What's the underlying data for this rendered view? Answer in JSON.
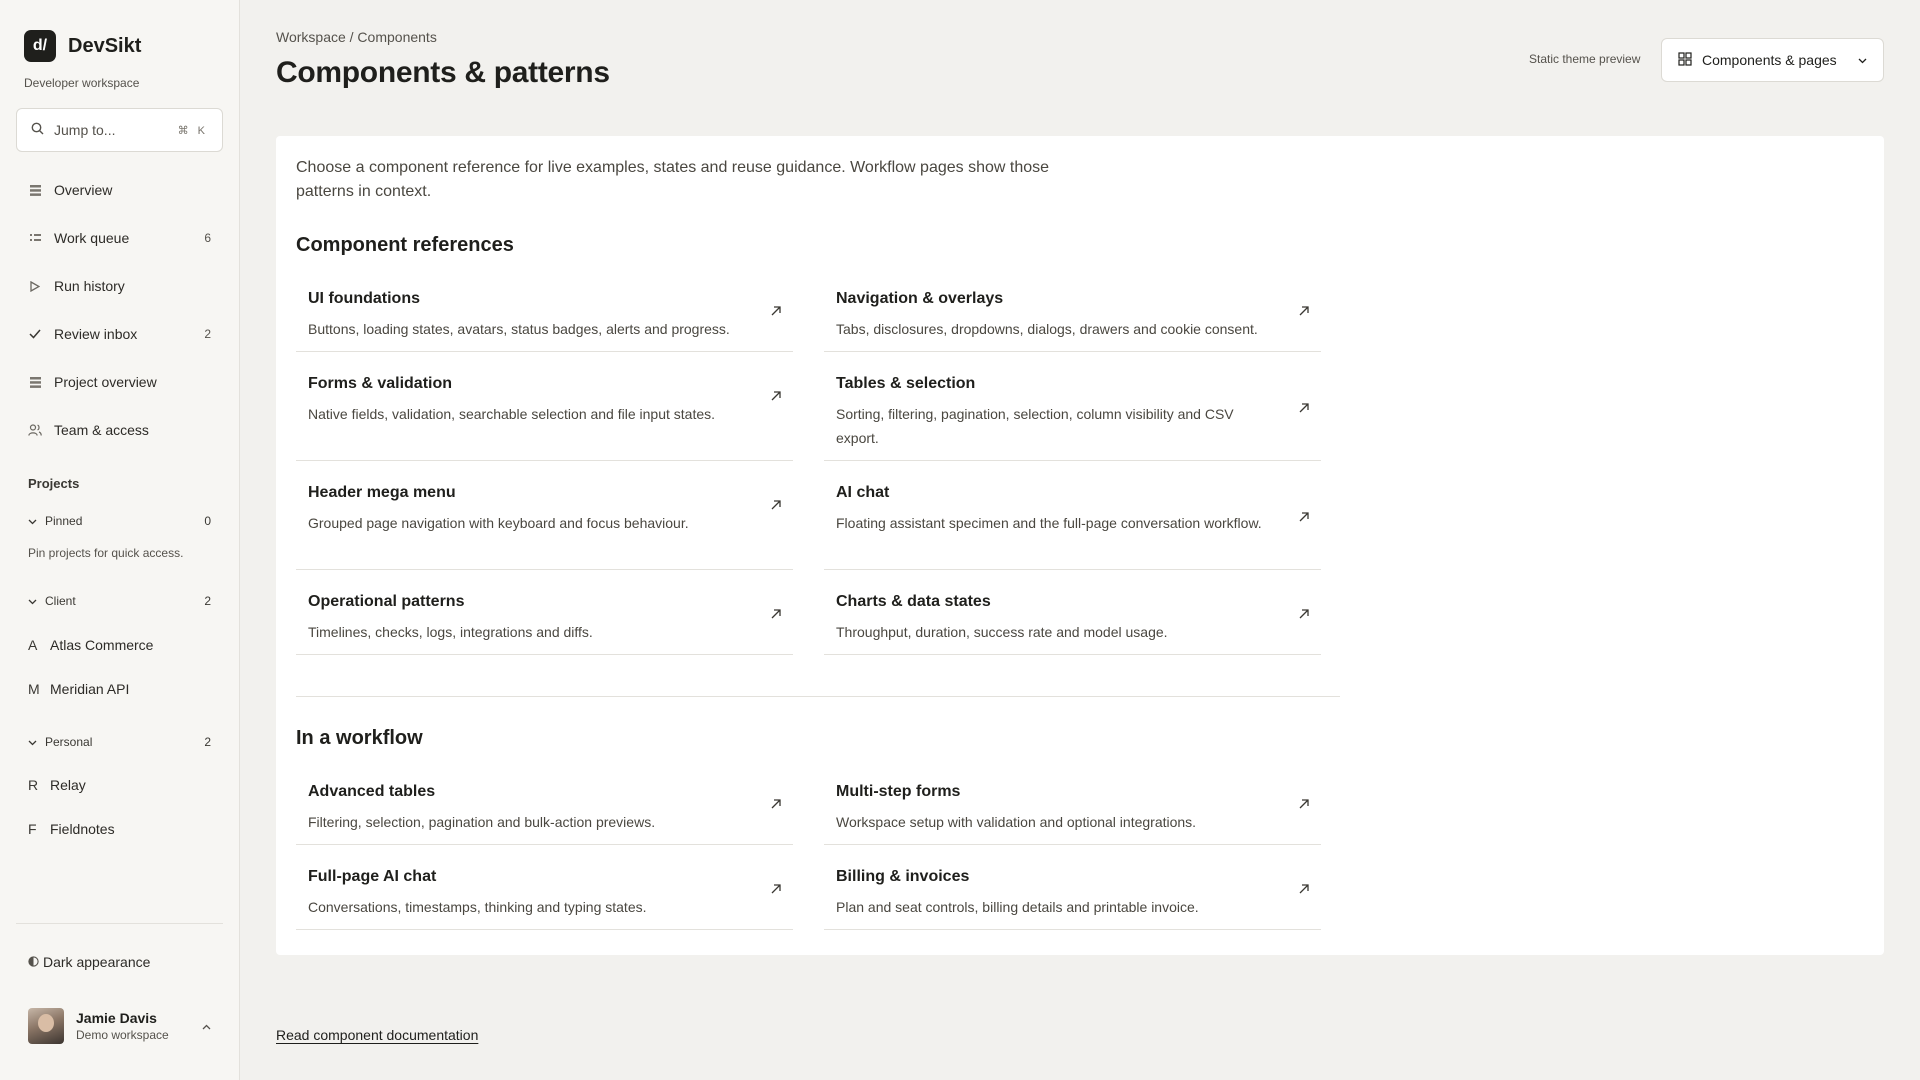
{
  "brand": {
    "logo": "d/",
    "name": "DevSikt",
    "subtitle": "Developer workspace"
  },
  "search": {
    "placeholder": "Jump to...",
    "shortcut": "⌘ K",
    "icon": "search-icon"
  },
  "nav": [
    {
      "label": "Overview",
      "icon": "grid-icon",
      "count": ""
    },
    {
      "label": "Work queue",
      "icon": "list-icon",
      "count": "6"
    },
    {
      "label": "Run history",
      "icon": "play-icon",
      "count": ""
    },
    {
      "label": "Review inbox",
      "icon": "check-icon",
      "count": "2"
    },
    {
      "label": "Project overview",
      "icon": "grid-icon",
      "count": ""
    },
    {
      "label": "Team & access",
      "icon": "users-icon",
      "count": ""
    }
  ],
  "projects": {
    "title": "Projects",
    "pinned": {
      "label": "Pinned",
      "count": "0",
      "note": "Pin projects for quick access."
    },
    "client": {
      "label": "Client",
      "count": "2",
      "items": [
        {
          "letter": "A",
          "name": "Atlas Commerce"
        },
        {
          "letter": "M",
          "name": "Meridian API"
        }
      ]
    },
    "personal": {
      "label": "Personal",
      "count": "2",
      "items": [
        {
          "letter": "R",
          "name": "Relay"
        },
        {
          "letter": "F",
          "name": "Fieldnotes"
        }
      ]
    }
  },
  "appearance": {
    "label": "Dark appearance",
    "icon": "half-circle-icon"
  },
  "user": {
    "name": "Jamie Davis",
    "workspace": "Demo workspace"
  },
  "header": {
    "breadcrumb": "Workspace / Components",
    "title": "Components & patterns",
    "theme_note": "Static theme preview",
    "view_select": "Components & pages"
  },
  "main": {
    "intro": "Choose a component reference for live examples, states and reuse guidance. Workflow pages show those patterns in context.",
    "component_references": {
      "title": "Component references",
      "cards": [
        {
          "title": "UI foundations",
          "desc": "Buttons, loading states, avatars, status badges, alerts and progress."
        },
        {
          "title": "Navigation & overlays",
          "desc": "Tabs, disclosures, dropdowns, dialogs, drawers and cookie consent."
        },
        {
          "title": "Forms & validation",
          "desc": "Native fields, validation, searchable selection and file input states."
        },
        {
          "title": "Tables & selection",
          "desc": "Sorting, filtering, pagination, selection, column visibility and CSV export."
        },
        {
          "title": "Header mega menu",
          "desc": "Grouped page navigation with keyboard and focus behaviour."
        },
        {
          "title": "AI chat",
          "desc": "Floating assistant specimen and the full-page conversation workflow."
        },
        {
          "title": "Operational patterns",
          "desc": "Timelines, checks, logs, integrations and diffs."
        },
        {
          "title": "Charts & data states",
          "desc": "Throughput, duration, success rate and model usage."
        }
      ]
    },
    "workflow": {
      "title": "In a workflow",
      "cards": [
        {
          "title": "Advanced tables",
          "desc": "Filtering, selection, pagination and bulk-action previews."
        },
        {
          "title": "Multi-step forms",
          "desc": "Workspace setup with validation and optional integrations."
        },
        {
          "title": "Full-page AI chat",
          "desc": "Conversations, timestamps, thinking and typing states."
        },
        {
          "title": "Billing & invoices",
          "desc": "Plan and seat controls, billing details and printable invoice."
        }
      ]
    }
  },
  "footer": {
    "doc_link": "Read component documentation"
  }
}
